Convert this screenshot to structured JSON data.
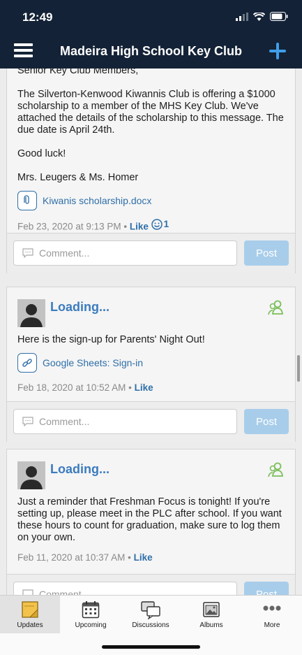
{
  "status_bar": {
    "time": "12:49"
  },
  "nav": {
    "title": "Madeira High School Key Club"
  },
  "posts": [
    {
      "body": [
        "Senior Key Club Members,",
        "The Silverton-Kenwood Kiwannis Club is offering a $1000 scholarship to a member of the MHS Key Club.  We've attached the details of the scholarship to this message.  The due date is April 24th.",
        "Good luck!",
        "Mrs. Leugers & Ms. Homer"
      ],
      "attachment": "Kiwanis scholarship.docx",
      "timestamp": "Feb 23, 2020 at 9:13 PM",
      "like_label": "Like",
      "like_count": "1",
      "comment_placeholder": "Comment...",
      "post_label": "Post"
    },
    {
      "author": "Loading...",
      "body": [
        "Here is the sign-up for Parents' Night Out!"
      ],
      "attachment": "Google Sheets: Sign-in",
      "timestamp": "Feb 18, 2020 at 10:52 AM",
      "like_label": "Like",
      "comment_placeholder": "Comment...",
      "post_label": "Post"
    },
    {
      "author": "Loading...",
      "body": [
        "Just a reminder that Freshman Focus is tonight! If you're setting up, please meet in the PLC after school.  If you want these hours to count for graduation, make sure to log them on your own."
      ],
      "timestamp": "Feb 11, 2020 at 10:37 AM",
      "like_label": "Like",
      "comment_placeholder": "Comment...",
      "post_label": "Post"
    }
  ],
  "tabs": [
    {
      "label": "Updates",
      "icon": "updates-icon",
      "active": true
    },
    {
      "label": "Upcoming",
      "icon": "calendar-icon"
    },
    {
      "label": "Discussions",
      "icon": "discussions-icon"
    },
    {
      "label": "Albums",
      "icon": "albums-icon"
    },
    {
      "label": "More",
      "icon": "more-icon"
    }
  ],
  "colors": {
    "nav_bg": "#132236",
    "accent": "#3f9ee8",
    "link": "#2f6fa8",
    "author": "#3b7bbf",
    "post_button": "#a8cdea",
    "group_icon": "#7bbf5a"
  }
}
